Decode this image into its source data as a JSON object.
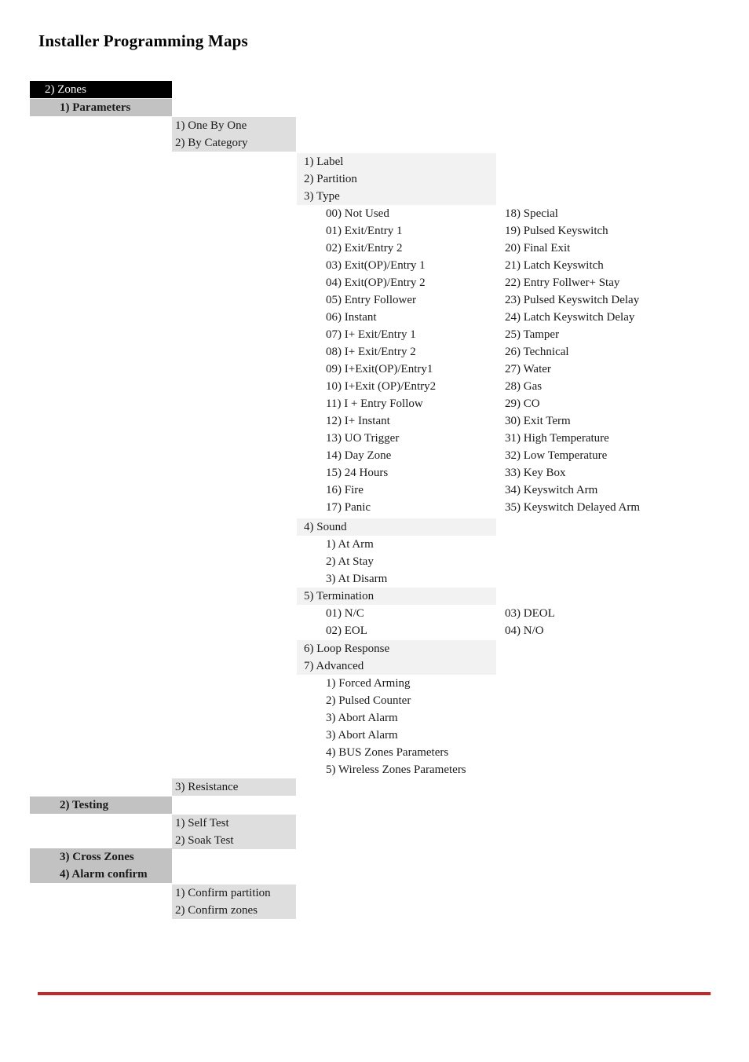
{
  "document": {
    "title": "Installer Programming Maps",
    "accent_rule_color": "#bf2a2a",
    "level_colors": {
      "level1_bg": "#000000",
      "level1_fg": "#ffffff",
      "level2_bg": "#c2c2c2",
      "level3_bg": "#dedede",
      "level4_bg": "#f2f2f2"
    }
  },
  "menu": {
    "root": "2) Zones",
    "parameters_heading": "1) Parameters",
    "mode_block": [
      "1) One By One",
      "2) By Category"
    ],
    "parameter_items": [
      "1) Label",
      "2) Partition",
      "3) Type"
    ],
    "zone_types_col1": [
      "00) Not Used",
      "01) Exit/Entry 1",
      "02) Exit/Entry 2",
      "03) Exit(OP)/Entry 1",
      "04) Exit(OP)/Entry 2",
      "05) Entry Follower",
      "06) Instant",
      "07) I+ Exit/Entry 1",
      "08) I+ Exit/Entry 2",
      "09) I+Exit(OP)/Entry1",
      "10) I+Exit (OP)/Entry2",
      "11) I + Entry Follow",
      "12) I+ Instant",
      "13) UO Trigger",
      "14) Day Zone",
      "15) 24 Hours",
      "16) Fire",
      "17) Panic"
    ],
    "zone_types_col2": [
      "18) Special",
      "19) Pulsed Keyswitch",
      "20) Final Exit",
      "21) Latch Keyswitch",
      "22) Entry Follwer+ Stay",
      "23) Pulsed Keyswitch Delay",
      "24) Latch Keyswitch Delay",
      "25) Tamper",
      "26) Technical",
      "27) Water",
      "28) Gas",
      "29) CO",
      "30) Exit Term",
      "31) High Temperature",
      "32) Low Temperature",
      "33) Key Box",
      "34) Keyswitch Arm",
      "35) Keyswitch Delayed Arm"
    ],
    "sound_heading": "4) Sound",
    "sound_items": [
      "1) At Arm",
      "2) At Stay",
      "3) At Disarm"
    ],
    "termination_heading": "5) Termination",
    "termination_col1": [
      "01) N/C",
      "02) EOL"
    ],
    "termination_col2": [
      "03) DEOL",
      "04) N/O"
    ],
    "loop_advanced": [
      "6) Loop Response",
      "7) Advanced"
    ],
    "advanced_items": [
      "1) Forced Arming",
      "2) Pulsed Counter",
      "3) Abort Alarm",
      "3) Abort Alarm",
      "4) BUS Zones Parameters",
      "5) Wireless Zones Parameters"
    ],
    "resistance_block": [
      "3) Resistance"
    ],
    "testing_heading": "2) Testing",
    "testing_items": [
      "1) Self Test",
      "2) Soak Test"
    ],
    "cross_zones_heading": "3) Cross Zones",
    "alarm_confirm_heading": "4) Alarm confirm",
    "alarm_confirm_items": [
      "1) Confirm partition",
      "2) Confirm zones"
    ]
  }
}
